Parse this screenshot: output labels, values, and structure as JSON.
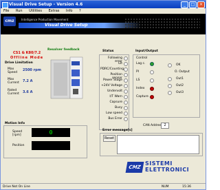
{
  "window": {
    "title": "Visual Drive Setup - Version 4.6"
  },
  "menu": [
    "File",
    "Run",
    "Utilities",
    "Extras",
    "Info",
    "?"
  ],
  "banner": {
    "logo": "cmz",
    "subtitle": "Intelligence Production Movement",
    "title": "Visual Drive Setup"
  },
  "device": {
    "model": "CS1 & K80/7.2",
    "mode": "Offline Mode",
    "feedback_title": "Resolver feedback"
  },
  "drive_limitation": {
    "title": "Drive Limitation",
    "rows": [
      {
        "label": "Max Speed",
        "value": "2500 rpm"
      },
      {
        "label": "Max Current",
        "value": "7.2 A"
      },
      {
        "label": "Rated Current",
        "value": "3.6 A"
      }
    ]
  },
  "status": {
    "title": "Status",
    "items": [
      "Following error",
      "I2t",
      "PDRC/Counting",
      "Position sensor",
      "Power Stage",
      "+24V Voltage",
      "Undervolt",
      "I/T Warn",
      "Capsure",
      "Busy",
      "Low speed",
      "Bus Error"
    ]
  },
  "io": {
    "title": "Input/Output",
    "control_label": "Control",
    "inputs": [
      {
        "label": "Lag c.",
        "state": "green"
      },
      {
        "label": "PI",
        "state": "off"
      },
      {
        "label": "LS",
        "state": "off"
      },
      {
        "label": "Index",
        "state": "red"
      },
      {
        "label": "Capture",
        "state": "red"
      }
    ],
    "outputs_title": "O. Output",
    "outputs": [
      {
        "label": "OK",
        "state": "off"
      },
      {
        "label": "Out1",
        "state": "off"
      },
      {
        "label": "Out2",
        "state": "off"
      },
      {
        "label": "Out3",
        "state": "off"
      }
    ],
    "can_address_label": "CAN Address",
    "can_address": "2"
  },
  "motion": {
    "title": "Motion Info",
    "speed_label": "Speed [rpm]",
    "speed_value": "0",
    "position_label": "Position",
    "position_value": ""
  },
  "errors": {
    "title": "Error message[s]",
    "reset_label": "Reset"
  },
  "brand": {
    "logo": "CMZ",
    "line1": "SISTEMI",
    "line2": "ELETTRONICI"
  },
  "statusbar": {
    "left": "Drive Not On Line",
    "mid": "NUM",
    "time": "15:36"
  }
}
